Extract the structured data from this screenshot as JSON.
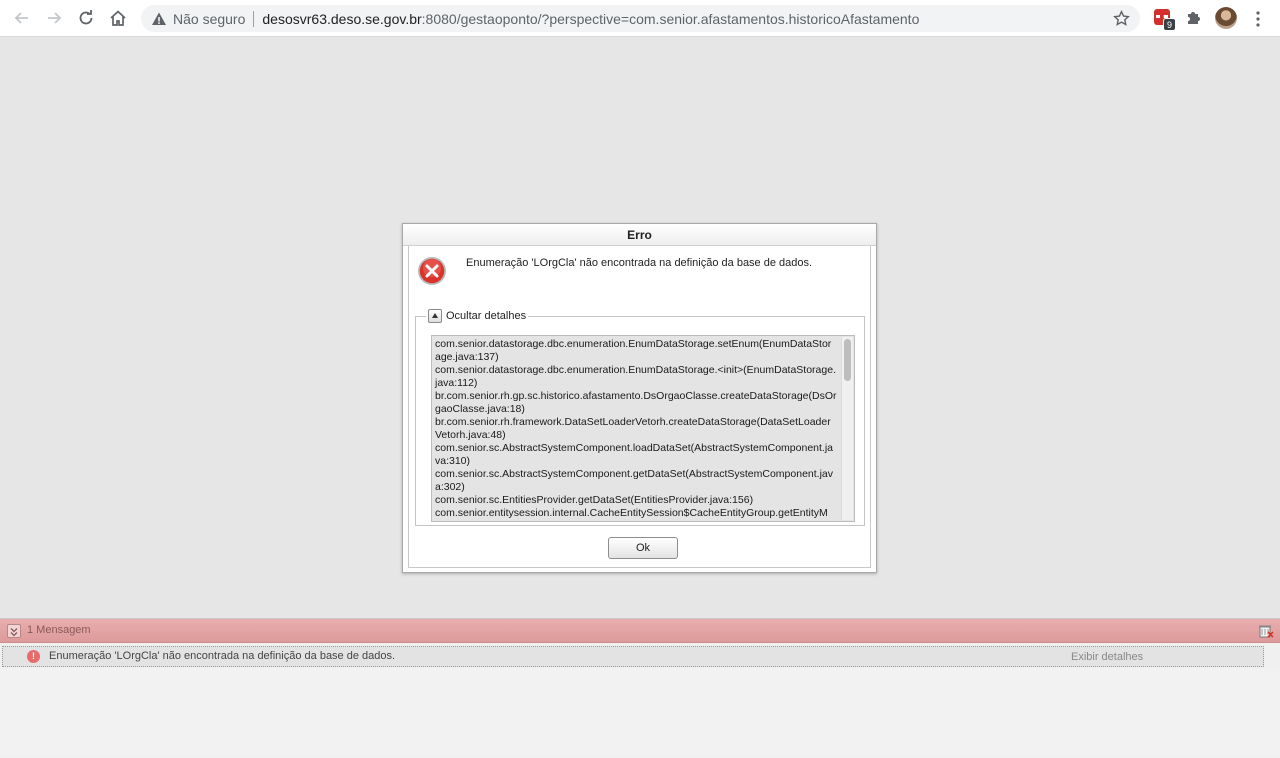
{
  "browser": {
    "security_label": "Não seguro",
    "url_host": "desosvr63.deso.se.gov.br",
    "url_rest": ":8080/gestaoponto/?perspective=com.senior.afastamentos.historicoAfastamento",
    "extension_badge_count": "9"
  },
  "dialog": {
    "title": "Erro",
    "message": "Enumeração 'LOrgCla' não encontrada na definição da base de dados.",
    "details_toggle_label": "Ocultar detalhes",
    "stack_trace": [
      "com.senior.datastorage.dbc.enumeration.EnumDataStorage.setEnum(EnumDataStorage.java:137)",
      "com.senior.datastorage.dbc.enumeration.EnumDataStorage.<init>(EnumDataStorage.java:112)",
      "br.com.senior.rh.gp.sc.historico.afastamento.DsOrgaoClasse.createDataStorage(DsOrgaoClasse.java:18)",
      "br.com.senior.rh.framework.DataSetLoaderVetorh.createDataStorage(DataSetLoaderVetorh.java:48)",
      "com.senior.sc.AbstractSystemComponent.loadDataSet(AbstractSystemComponent.java:310)",
      "com.senior.sc.AbstractSystemComponent.getDataSet(AbstractSystemComponent.java:302)",
      "com.senior.sc.EntitiesProvider.getDataSet(EntitiesProvider.java:156)",
      "com.senior.entitysession.internal.CacheEntitySession$CacheEntityGroup.getEntityM"
    ],
    "ok_label": "Ok"
  },
  "messages": {
    "count_label": "1 Mensagem",
    "items": [
      {
        "text": "Enumeração 'LOrgCla' não encontrada na definição da base de dados.",
        "details_link": "Exibir detalhes",
        "icon": "error-icon"
      }
    ]
  },
  "colors": {
    "message_header": "#de9a9a",
    "error_red": "#d9342b"
  }
}
